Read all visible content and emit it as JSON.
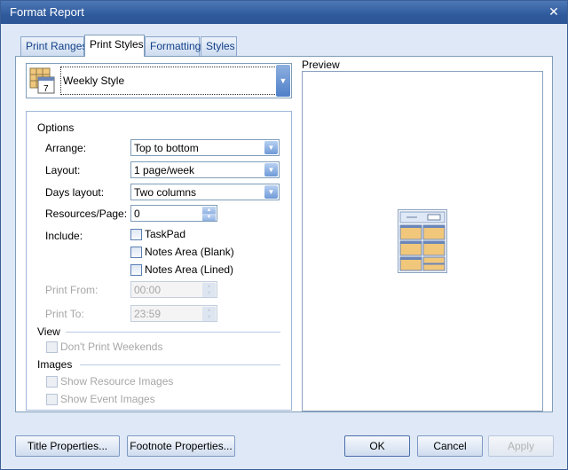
{
  "window": {
    "title": "Format Report"
  },
  "tabs": [
    {
      "label": "Print Ranges",
      "active": false
    },
    {
      "label": "Print Styles",
      "active": true
    },
    {
      "label": "Formatting",
      "active": false
    },
    {
      "label": "Styles",
      "active": false
    }
  ],
  "style_picker": {
    "value": "Weekly Style",
    "icon": "calendar-7-icon"
  },
  "options": {
    "title": "Options",
    "arrange": {
      "label": "Arrange:",
      "value": "Top to bottom"
    },
    "layout": {
      "label": "Layout:",
      "value": "1 page/week"
    },
    "days_layout": {
      "label": "Days layout:",
      "value": "Two columns"
    },
    "resources_per_page": {
      "label": "Resources/Page:",
      "value": "0"
    },
    "include": {
      "label": "Include:",
      "items": [
        {
          "label": "TaskPad",
          "checked": false
        },
        {
          "label": "Notes Area (Blank)",
          "checked": false
        },
        {
          "label": "Notes Area (Lined)",
          "checked": false
        }
      ]
    },
    "print_from": {
      "label": "Print From:",
      "value": "00:00"
    },
    "print_to": {
      "label": "Print To:",
      "value": "23:59"
    }
  },
  "view": {
    "title": "View",
    "dont_print_weekends": {
      "label": "Don't Print Weekends",
      "checked": false
    }
  },
  "images": {
    "title": "Images",
    "show_resource_images": {
      "label": "Show Resource Images",
      "checked": false
    },
    "show_event_images": {
      "label": "Show Event Images",
      "checked": false
    }
  },
  "preview": {
    "label": "Preview"
  },
  "buttons": {
    "title_properties": "Title Properties...",
    "footnote_properties": "Footnote Properties...",
    "ok": "OK",
    "cancel": "Cancel",
    "apply": "Apply"
  },
  "colors": {
    "titlebar": "#2f5a9c",
    "dialog_bg": "#dfe8f6",
    "border": "#7f9db9",
    "tab_text": "#15428b",
    "disabled_text": "#a7a7a7"
  }
}
